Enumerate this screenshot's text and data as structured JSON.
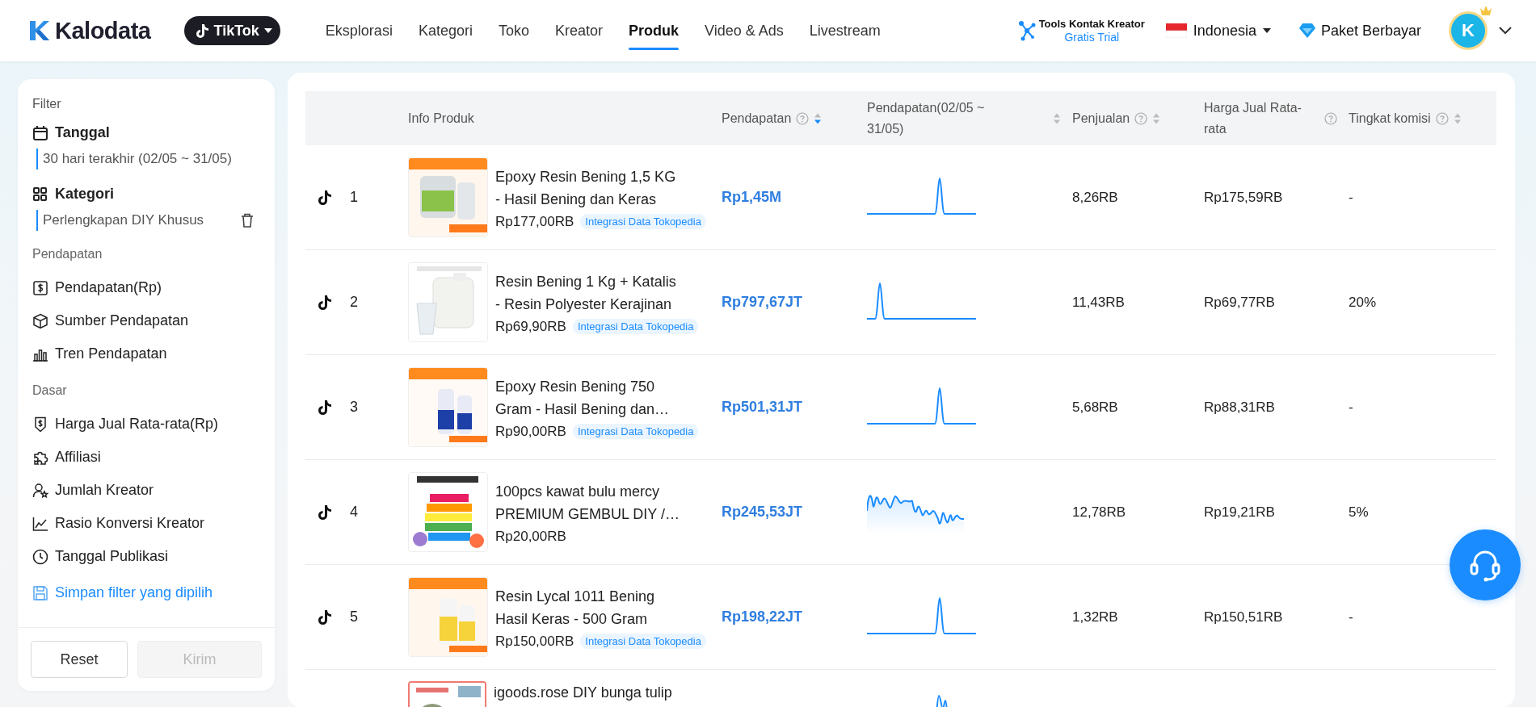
{
  "header": {
    "logo": "Kalodata",
    "platform": "TikTok",
    "nav": [
      {
        "label": "Eksplorasi",
        "selected": false
      },
      {
        "label": "Kategori",
        "selected": false
      },
      {
        "label": "Toko",
        "selected": false
      },
      {
        "label": "Kreator",
        "selected": false
      },
      {
        "label": "Produk",
        "selected": true
      },
      {
        "label": "Video & Ads",
        "selected": false
      },
      {
        "label": "Livestream",
        "selected": false
      }
    ],
    "tools": {
      "title": "Tools Kontak Kreator",
      "subtitle": "Gratis Trial"
    },
    "region": "Indonesia",
    "plan": "Paket Berbayar",
    "avatar": "K"
  },
  "sidebar": {
    "title": "Filter",
    "filters": [
      {
        "label": "Tanggal",
        "value": "30 hari terakhir (02/05 ~ 31/05)",
        "removable": false
      },
      {
        "label": "Kategori",
        "value": "Perlengkapan DIY Khusus",
        "removable": true
      }
    ],
    "groups": [
      {
        "title": "Pendapatan",
        "items": [
          "Pendapatan(Rp)",
          "Sumber Pendapatan",
          "Tren Pendapatan"
        ]
      },
      {
        "title": "Dasar",
        "items": [
          "Harga Jual Rata-rata(Rp)",
          "Affiliasi",
          "Jumlah Kreator",
          "Rasio Konversi Kreator",
          "Tanggal Publikasi"
        ]
      }
    ],
    "save_link": "Simpan filter yang dipilih",
    "buttons": [
      {
        "label": "Reset",
        "disabled": false
      },
      {
        "label": "Kirim",
        "disabled": true
      }
    ]
  },
  "table": {
    "columns": [
      {
        "label": "Info Produk",
        "help": false,
        "sortable": false
      },
      {
        "label": "Pendapatan",
        "help": true,
        "sortable": true,
        "sorted": true
      },
      {
        "label": "Pendapatan(02/05 ~ 31/05)",
        "help": false,
        "sortable": true,
        "sorted": false
      },
      {
        "label": "Penjualan",
        "help": true,
        "sortable": true,
        "sorted": false
      },
      {
        "label": "Harga Jual Rata-rata",
        "help": true,
        "sortable": false
      },
      {
        "label": "Tingkat komisi",
        "help": true,
        "sortable": true,
        "sorted": false
      }
    ],
    "rows": [
      {
        "rank": "1",
        "title": "Epoxy Resin Bening 1,5 KG - Hasil Bening dan Keras",
        "price": "Rp177,00RB",
        "tag": "Integrasi Data Tokopedia",
        "revenue": "Rp1,45M",
        "trend": {
          "kind": "spike-middle"
        },
        "sales": "8,26RB",
        "avg_price": "Rp175,59RB",
        "commission": "-"
      },
      {
        "rank": "2",
        "title": "Resin Bening 1 Kg + Katalis - Resin Polyester Kerajinan",
        "price": "Rp69,90RB",
        "tag": "Integrasi Data Tokopedia",
        "revenue": "Rp797,67JT",
        "trend": {
          "kind": "spike-start"
        },
        "sales": "11,43RB",
        "avg_price": "Rp69,77RB",
        "commission": "20%"
      },
      {
        "rank": "3",
        "title": "Epoxy Resin Bening 750 Gram - Hasil Bening dan…",
        "price": "Rp90,00RB",
        "tag": "Integrasi Data Tokopedia",
        "revenue": "Rp501,31JT",
        "trend": {
          "kind": "spike-middle"
        },
        "sales": "5,68RB",
        "avg_price": "Rp88,31RB",
        "commission": "-"
      },
      {
        "rank": "4",
        "title": "100pcs kawat bulu mercy PREMIUM GEMBUL DIY /…",
        "price": "Rp20,00RB",
        "revenue": "Rp245,53JT",
        "trend": {
          "kind": "wave"
        },
        "sales": "12,78RB",
        "avg_price": "Rp19,21RB",
        "commission": "5%"
      },
      {
        "rank": "5",
        "title": "Resin Lycal 1011 Bening Hasil Keras - 500 Gram",
        "price": "Rp150,00RB",
        "tag": "Integrasi Data Tokopedia",
        "revenue": "Rp198,22JT",
        "trend": {
          "kind": "spike-middle"
        },
        "sales": "1,32RB",
        "avg_price": "Rp150,51RB",
        "commission": "-"
      },
      {
        "title": "igoods.rose DIY bunga tulip",
        "trend": {
          "kind": "double-spike"
        }
      }
    ]
  }
}
